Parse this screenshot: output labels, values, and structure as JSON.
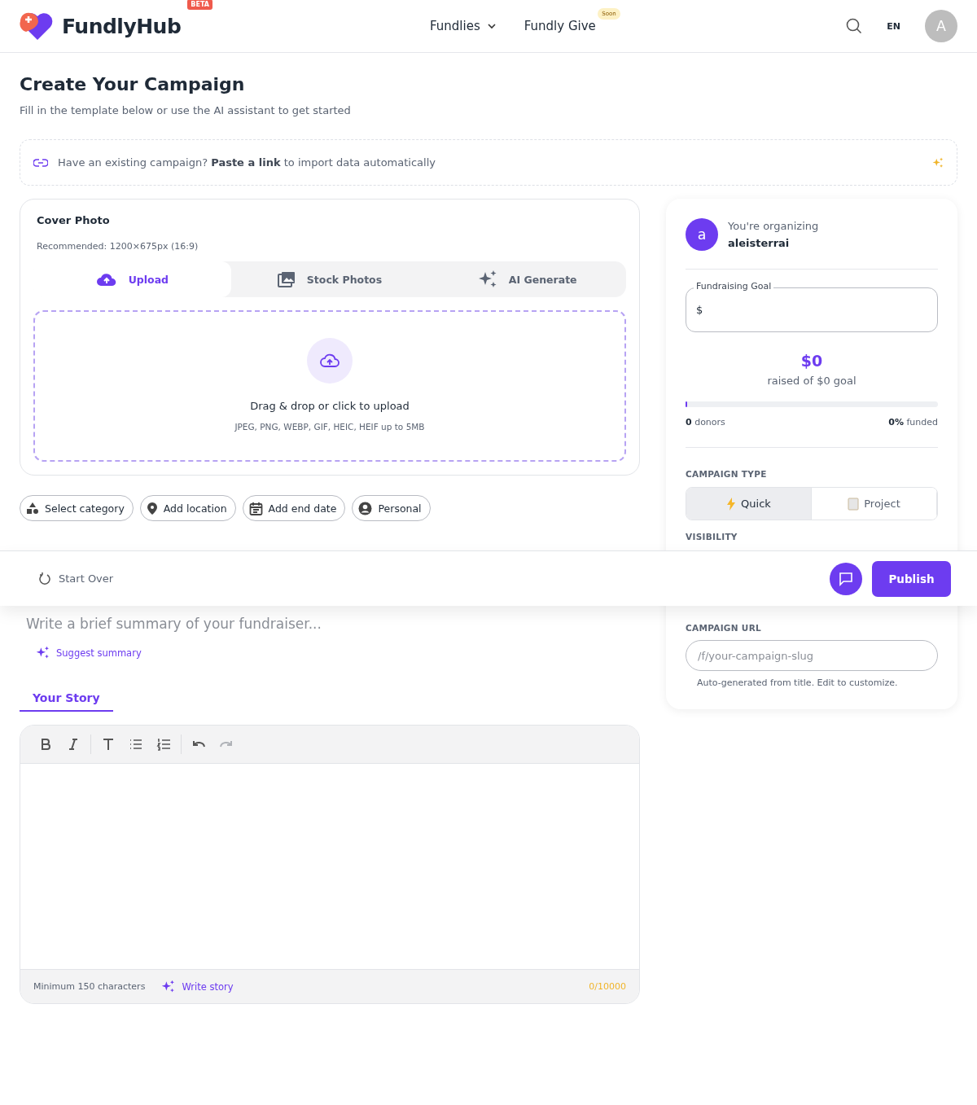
{
  "header": {
    "brand": "FundlyHub",
    "badge": "BETA",
    "nav": [
      {
        "label": "Fundlies",
        "kind": "dropdown"
      },
      {
        "label": "Fundly Give",
        "kind": "soon",
        "tag": "Soon"
      }
    ],
    "language": "EN",
    "avatar": "A"
  },
  "page": {
    "title": "Create Your Campaign",
    "subtitle": "Fill in the template below or use the AI assistant to get started"
  },
  "import_bar": {
    "text": "Have an existing campaign? **Paste a link** to import data automatically"
  },
  "cover_photo": {
    "title": "Cover Photo",
    "hint": "Recommended: 1200×675px (16:9)",
    "tabs": [
      {
        "label": "Upload",
        "kind": "upload",
        "selected": true
      },
      {
        "label": "Stock Photos",
        "kind": "stock",
        "selected": false
      },
      {
        "label": "AI Generate",
        "kind": "ai",
        "selected": false
      }
    ],
    "dropzone": {
      "title": "Drag & drop or click to upload",
      "formats": "JPEG, PNG, WEBP, GIF, HEIC, HEIF up to 5MB"
    }
  },
  "chips": [
    {
      "label": "Select category",
      "kind": "category"
    },
    {
      "label": "Add location",
      "kind": "location"
    },
    {
      "label": "Add end date",
      "kind": "date"
    },
    {
      "label": "Personal",
      "kind": "person"
    }
  ],
  "summary": {
    "placeholder": "Write a brief summary of your fundraiser...",
    "suggest": "Suggest summary"
  },
  "story_tabs": [
    {
      "label": "Your Story",
      "selected": true
    }
  ],
  "editor": {
    "tools": [
      {
        "kind": "bold",
        "disabled": false
      },
      {
        "kind": "italic",
        "disabled": false
      },
      {
        "kind": "heading",
        "disabled": false
      },
      {
        "kind": "bullets",
        "disabled": false
      },
      {
        "kind": "numbers",
        "disabled": false
      },
      {
        "kind": "undo",
        "disabled": false
      },
      {
        "kind": "redo",
        "disabled": true
      }
    ],
    "min_note": "Minimum 150 characters",
    "write_story": "Write story",
    "counter": "0/10000"
  },
  "sidebar": {
    "organizing_label": "You're organizing",
    "organizer": "aleisterrai",
    "avatar": "a",
    "goal_label": "Fundraising Goal",
    "currency": "$",
    "raised": "$0",
    "raised_of": "raised of $0 goal",
    "level": 0,
    "donors_count": "0",
    "donors_label": "donors",
    "funded_pct": "0%",
    "funded_label": "funded",
    "type_label": "CAMPAIGN TYPE",
    "types": [
      {
        "label": "Quick",
        "kind": "quick",
        "selected": true
      },
      {
        "label": "Project",
        "kind": "project",
        "selected": false
      }
    ],
    "visibility_label": "VISIBILITY",
    "url_label": "CAMPAIGN URL",
    "url_placeholder": "/f/your-campaign-slug",
    "url_hint": "Auto-generated from title. Edit to customize."
  },
  "bottom_bar": {
    "start_over": "Start Over",
    "publish": "Publish"
  }
}
